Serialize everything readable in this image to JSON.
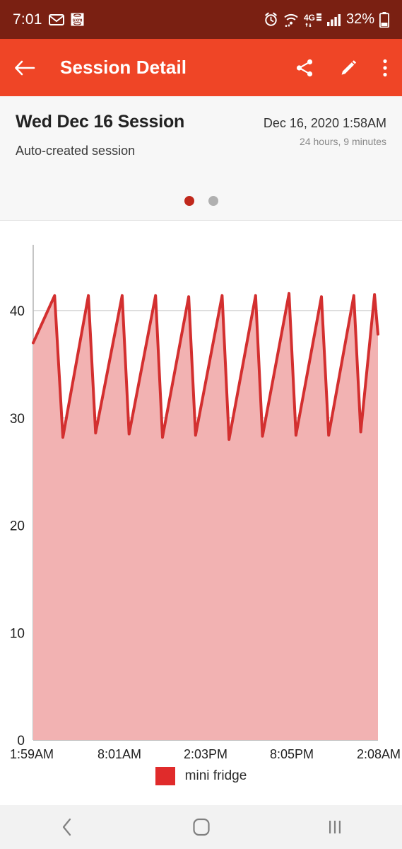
{
  "status_bar": {
    "clock": "7:01",
    "battery_percent": "32%",
    "icons": [
      "mail-icon",
      "siriusxm-icon",
      "alarm-icon",
      "wifi-icon",
      "4g-lte-icon",
      "signal-bars-icon",
      "battery-icon"
    ],
    "background_color": "#7a2012"
  },
  "app_bar": {
    "title": "Session Detail",
    "back_icon": "back-arrow-icon",
    "share_icon": "share-icon",
    "edit_icon": "pencil-edit-icon",
    "overflow_icon": "more-vertical-icon",
    "background_color": "#ef4526"
  },
  "session": {
    "title": "Wed Dec 16 Session",
    "subtitle": "Auto-created session",
    "date": "Dec 16, 2020 1:58AM",
    "duration": "24 hours, 9 minutes",
    "page_dots": [
      {
        "state": "active",
        "color": "#c0281c"
      },
      {
        "state": "inactive",
        "color": "#b0b0b0"
      }
    ]
  },
  "legend": {
    "label": "mini fridge",
    "swatch_color": "#e02b2b"
  },
  "nav_bar": {
    "back_icon": "nav-back-icon",
    "home_icon": "nav-home-icon",
    "recents_icon": "nav-recents-icon"
  },
  "chart_data": {
    "type": "area",
    "title": "",
    "xlabel": "",
    "ylabel": "",
    "grid": true,
    "legend_position": "bottom",
    "series_name": "mini fridge",
    "line_color": "#d32f2f",
    "fill_color": "#f2b2b2",
    "ylim": [
      0,
      46
    ],
    "yticks": [
      0,
      10,
      20,
      30,
      40
    ],
    "xticks": [
      "1:59AM",
      "8:01AM",
      "2:03PM",
      "8:05PM",
      "2:08AM"
    ],
    "xtick_positions": [
      0,
      0.25,
      0.5,
      0.75,
      1.0
    ],
    "peak_value": 41.5,
    "trough_value": 28.3,
    "cycle_count": 10,
    "x": [
      0.0,
      0.062,
      0.086,
      0.16,
      0.181,
      0.258,
      0.278,
      0.355,
      0.375,
      0.451,
      0.471,
      0.548,
      0.568,
      0.645,
      0.665,
      0.742,
      0.762,
      0.836,
      0.857,
      0.93,
      0.95,
      0.99,
      1.0
    ],
    "values": [
      37.0,
      41.4,
      28.2,
      41.4,
      28.6,
      41.4,
      28.5,
      41.4,
      28.2,
      41.3,
      28.4,
      41.4,
      28.0,
      41.4,
      28.3,
      41.6,
      28.4,
      41.3,
      28.4,
      41.4,
      28.7,
      41.5,
      37.8
    ]
  }
}
